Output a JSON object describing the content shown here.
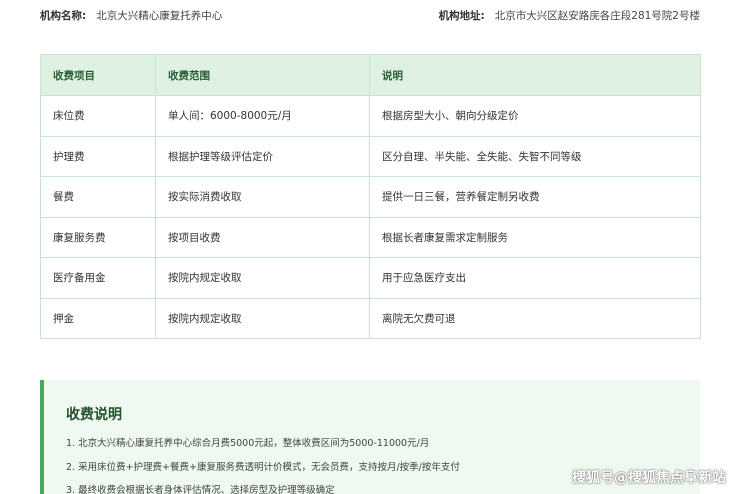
{
  "header": {
    "org_name_label": "机构名称:",
    "org_name_value": "北京大兴精心康复托养中心",
    "address_label": "机构地址:",
    "address_value": "北京市大兴区赵安路庑各庄段281号院2号楼"
  },
  "table": {
    "headers": [
      "收费项目",
      "收费范围",
      "说明"
    ],
    "rows": [
      [
        "床位费",
        "单人间：6000-8000元/月",
        "根据房型大小、朝向分级定价"
      ],
      [
        "护理费",
        "根据护理等级评估定价",
        "区分自理、半失能、全失能、失智不同等级"
      ],
      [
        "餐费",
        "按实际消费收取",
        "提供一日三餐，营养餐定制另收费"
      ],
      [
        "康复服务费",
        "按项目收费",
        "根据长者康复需求定制服务"
      ],
      [
        "医疗备用金",
        "按院内规定收取",
        "用于应急医疗支出"
      ],
      [
        "押金",
        "按院内规定收取",
        "离院无欠费可退"
      ]
    ]
  },
  "notes": {
    "title": "收费说明",
    "items": [
      "1. 北京大兴精心康复托养中心综合月费5000元起，整体收费区间为5000-11000元/月",
      "2. 采用床位费+护理费+餐费+康复服务费透明计价模式，无会员费，支持按月/按季/按年支付",
      "3. 最终收费会根据长者身体评估情况、选择房型及护理等级确定"
    ]
  },
  "watermark": "搜狐号@搜狐焦点阜新站",
  "colors": {
    "header_bg": "#dff1e3",
    "header_text": "#2a5d35",
    "border": "#c9e5cf",
    "notes_bg": "#eff8f1",
    "accent": "#45a85a"
  }
}
